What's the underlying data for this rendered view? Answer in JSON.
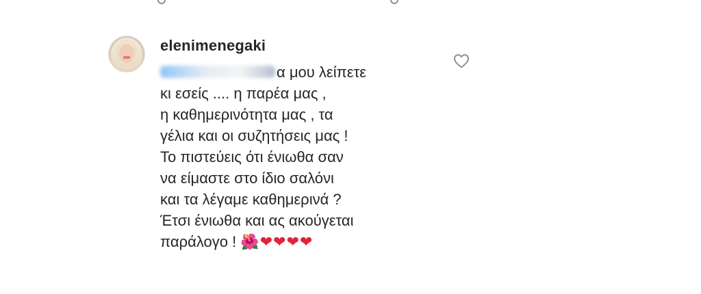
{
  "comment": {
    "username": "elenimenegaki",
    "lines": [
      "α μου λείπετε",
      "κι εσείς .... η παρέα μας ,",
      "η καθημερινότητα μας , τα",
      "γέλια και οι συζητήσεις μας !",
      "Το πιστεύεις ότι ένιωθα σαν",
      "να είμαστε στο ίδιο σαλόνι",
      "και τα λέγαμε καθημερινά ?",
      "Έτσι ένιωθα και ας ακούγεται",
      "παράλογο !"
    ],
    "emojis": {
      "flower": "🌺",
      "hearts": [
        "❤",
        "❤",
        "❤",
        "❤"
      ]
    },
    "icons": {
      "avatar": "profile-photo",
      "like": "heart-outline-icon"
    },
    "colors": {
      "text": "#262626",
      "icon": "#8e8e8e",
      "heart": "#e0243a"
    }
  }
}
